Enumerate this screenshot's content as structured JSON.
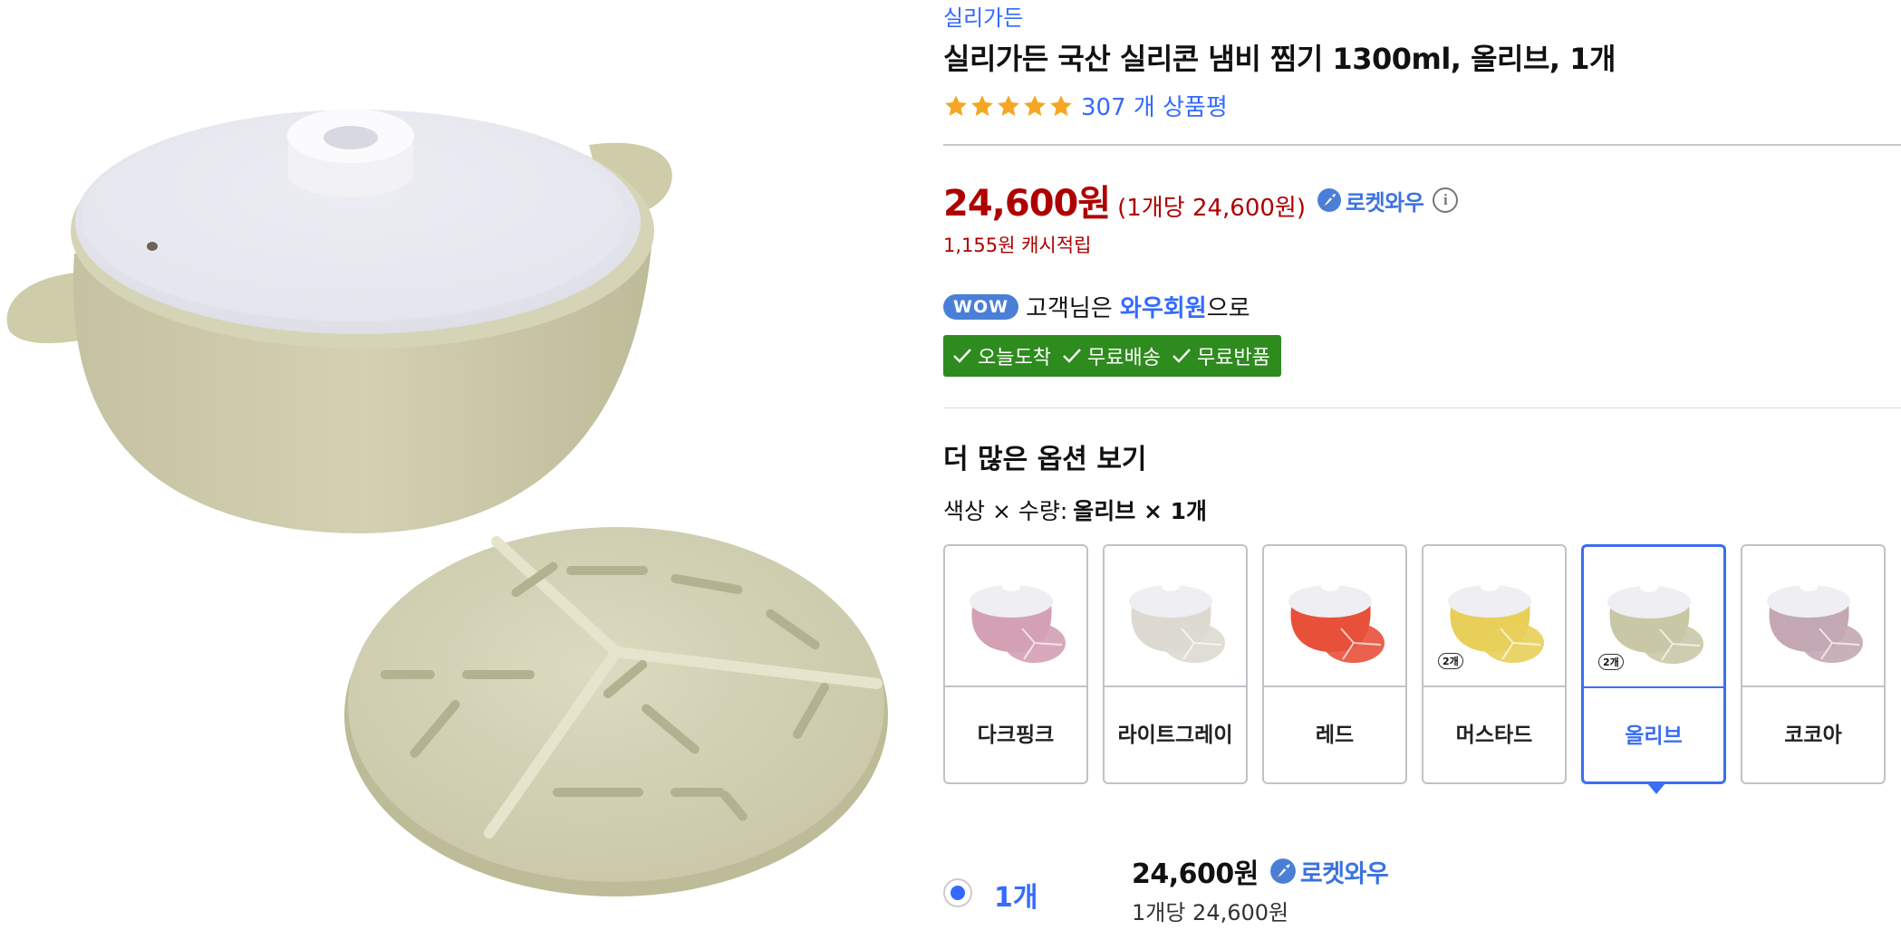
{
  "brand": "실리가든",
  "title": "실리가든 국산 실리콘 냄비 찜기 1300ml, 올리브, 1개",
  "rating": {
    "stars": 5,
    "review_count": "307 개 상품평"
  },
  "price": {
    "main": "24,600원",
    "unit": "(1개당 24,600원)",
    "rocket_label": "로켓와우",
    "cashback": "1,155원 캐시적립"
  },
  "wow": {
    "badge": "WOW",
    "prefix": "고객님은 ",
    "strong": "와우회원",
    "suffix": "으로"
  },
  "benefits": [
    "오늘도착",
    "무료배송",
    "무료반품"
  ],
  "options": {
    "heading": "더 많은 옵션 보기",
    "selection_label": "색상 × 수량:",
    "selection_value": "올리브 × 1개",
    "swatches": [
      {
        "label": "다크핑크",
        "color": "#d4a0b4",
        "badge": ""
      },
      {
        "label": "라이트그레이",
        "color": "#ddd9d0",
        "badge": ""
      },
      {
        "label": "레드",
        "color": "#e8503a",
        "badge": ""
      },
      {
        "label": "머스타드",
        "color": "#e8cf5a",
        "badge": "2개"
      },
      {
        "label": "올리브",
        "color": "#c9c8a6",
        "badge": "2개",
        "selected": true
      },
      {
        "label": "코코아",
        "color": "#c3a8b3",
        "badge": ""
      }
    ]
  },
  "quantity": {
    "label": "1개",
    "price": "24,600원",
    "rocket_label": "로켓와우",
    "unit": "1개당 24,600원"
  },
  "colors": {
    "accent": "#346aff",
    "price": "#ae0000",
    "green": "#2e8b1e",
    "olive": "#cfcdb0"
  }
}
